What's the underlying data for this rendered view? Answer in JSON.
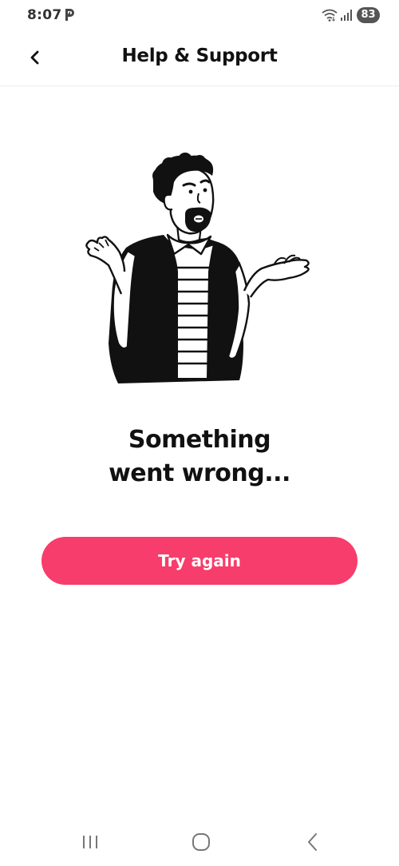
{
  "status_bar": {
    "time": "8:07",
    "battery_level": "83",
    "icons": [
      "parking-app-icon",
      "wifi-icon",
      "signal-icon",
      "battery-icon"
    ]
  },
  "header": {
    "title": "Help & Support",
    "back_icon": "chevron-left-icon"
  },
  "illustration": {
    "icon": "confused-man-shrug-illustration"
  },
  "error": {
    "line1": "Something",
    "line2": "went wrong..."
  },
  "actions": {
    "try_again_label": "Try again"
  },
  "nav_bar": {
    "icons": [
      "recents-icon",
      "home-icon",
      "back-icon"
    ]
  },
  "colors": {
    "accent": "#f73d6b",
    "text": "#111111",
    "background": "#ffffff"
  }
}
